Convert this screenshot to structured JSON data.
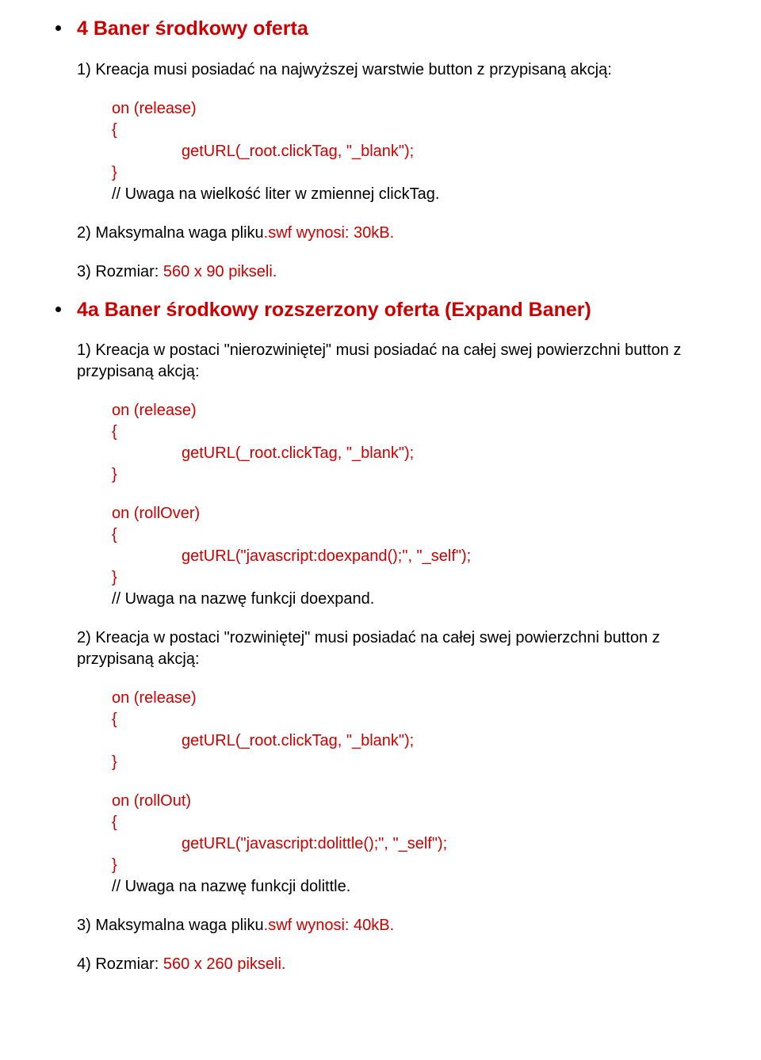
{
  "section4": {
    "heading": "4 Baner środkowy oferta",
    "step1_text": "1) Kreacja musi posiadać na najwyższej warstwie button z przypisaną akcją:",
    "code1": {
      "on": "on (release)",
      "open": "{",
      "body": "getURL(_root.clickTag, \"_blank\");",
      "close": "}",
      "comment": "// Uwaga na wielkość liter w zmiennej clickTag."
    },
    "step2_pre": "2) Maksymalna waga pliku",
    "step2_post": ".swf wynosi: 30kB.",
    "step3_pre": "3) Rozmiar: ",
    "step3_post": "560 x 90 pikseli."
  },
  "section4a": {
    "heading": "4a Baner środkowy rozszerzony oferta (Expand Baner)",
    "step1_text": "1) Kreacja w postaci \"nierozwiniętej\" musi posiadać na całej swej powierzchni button z przypisaną akcją:",
    "code1": {
      "on": "on (release)",
      "open": "{",
      "body": "getURL(_root.clickTag, \"_blank\");",
      "close": "}"
    },
    "code2": {
      "on": "on (rollOver)",
      "open": "{",
      "body": "getURL(\"javascript:doexpand();\", \"_self\");",
      "close": "}",
      "comment": "// Uwaga na nazwę funkcji doexpand."
    },
    "step2_text": "2) Kreacja w postaci \"rozwiniętej\" musi posiadać na całej swej powierzchni button z przypisaną akcją:",
    "code3": {
      "on": "on (release)",
      "open": "{",
      "body": "getURL(_root.clickTag, \"_blank\");",
      "close": "}"
    },
    "code4": {
      "on": "on (rollOut)",
      "open": "{",
      "body": "getURL(\"javascript:dolittle();\", \"_self\");",
      "close": "}",
      "comment": "// Uwaga na nazwę funkcji dolittle."
    },
    "step3_pre": "3) Maksymalna waga pliku",
    "step3_post": ".swf wynosi: 40kB.",
    "step4_pre": "4) Rozmiar: ",
    "step4_post": "560 x 260 pikseli."
  }
}
